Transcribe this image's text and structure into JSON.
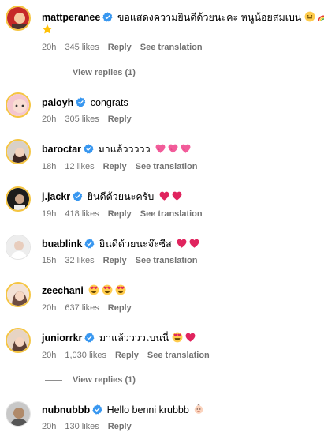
{
  "comments": [
    {
      "user": "mattperanee",
      "verified": true,
      "text": "ขอแสดงความยินดีด้วยนะคะ หนูน้อยสมเบน",
      "emojis": "face-rainbow-star",
      "time": "20h",
      "likes": "345 likes",
      "reply": "Reply",
      "translate": "See translation"
    },
    {
      "user": "paloyh",
      "verified": true,
      "text": "congrats",
      "time": "20h",
      "likes": "305 likes",
      "reply": "Reply"
    },
    {
      "user": "baroctar",
      "verified": true,
      "text": "มาแล้ววววว",
      "emojis": "hearts-pink-3",
      "time": "18h",
      "likes": "12 likes",
      "reply": "Reply",
      "translate": "See translation"
    },
    {
      "user": "j.jackr",
      "verified": true,
      "text": "ยินดีด้วยนะครับ",
      "emojis": "hearts-red-2",
      "time": "19h",
      "likes": "418 likes",
      "reply": "Reply",
      "translate": "See translation"
    },
    {
      "user": "buablink",
      "verified": true,
      "text": "ยินดีด้วยนะจ๊ะซีส",
      "emojis": "hearts-red-2",
      "time": "15h",
      "likes": "32 likes",
      "reply": "Reply",
      "translate": "See translation"
    },
    {
      "user": "zeechani",
      "verified": false,
      "text": "",
      "emojis": "heart-eyes-3",
      "time": "20h",
      "likes": "637 likes",
      "reply": "Reply"
    },
    {
      "user": "juniorrkr",
      "verified": true,
      "text": "มาแล้ววววเบนนี่",
      "emojis": "heart-eyes-heart",
      "time": "20h",
      "likes": "1,030 likes",
      "reply": "Reply",
      "translate": "See translation"
    },
    {
      "user": "nubnubbb",
      "verified": true,
      "text": "Hello benni krubbb",
      "emojis": "baby",
      "time": "20h",
      "likes": "130 likes",
      "reply": "Reply"
    }
  ],
  "view_replies": [
    "View replies (1)",
    "View replies (1)"
  ],
  "colors": {
    "verified": "#3897f0",
    "meta": "#737373",
    "heart": "#e0245e"
  }
}
